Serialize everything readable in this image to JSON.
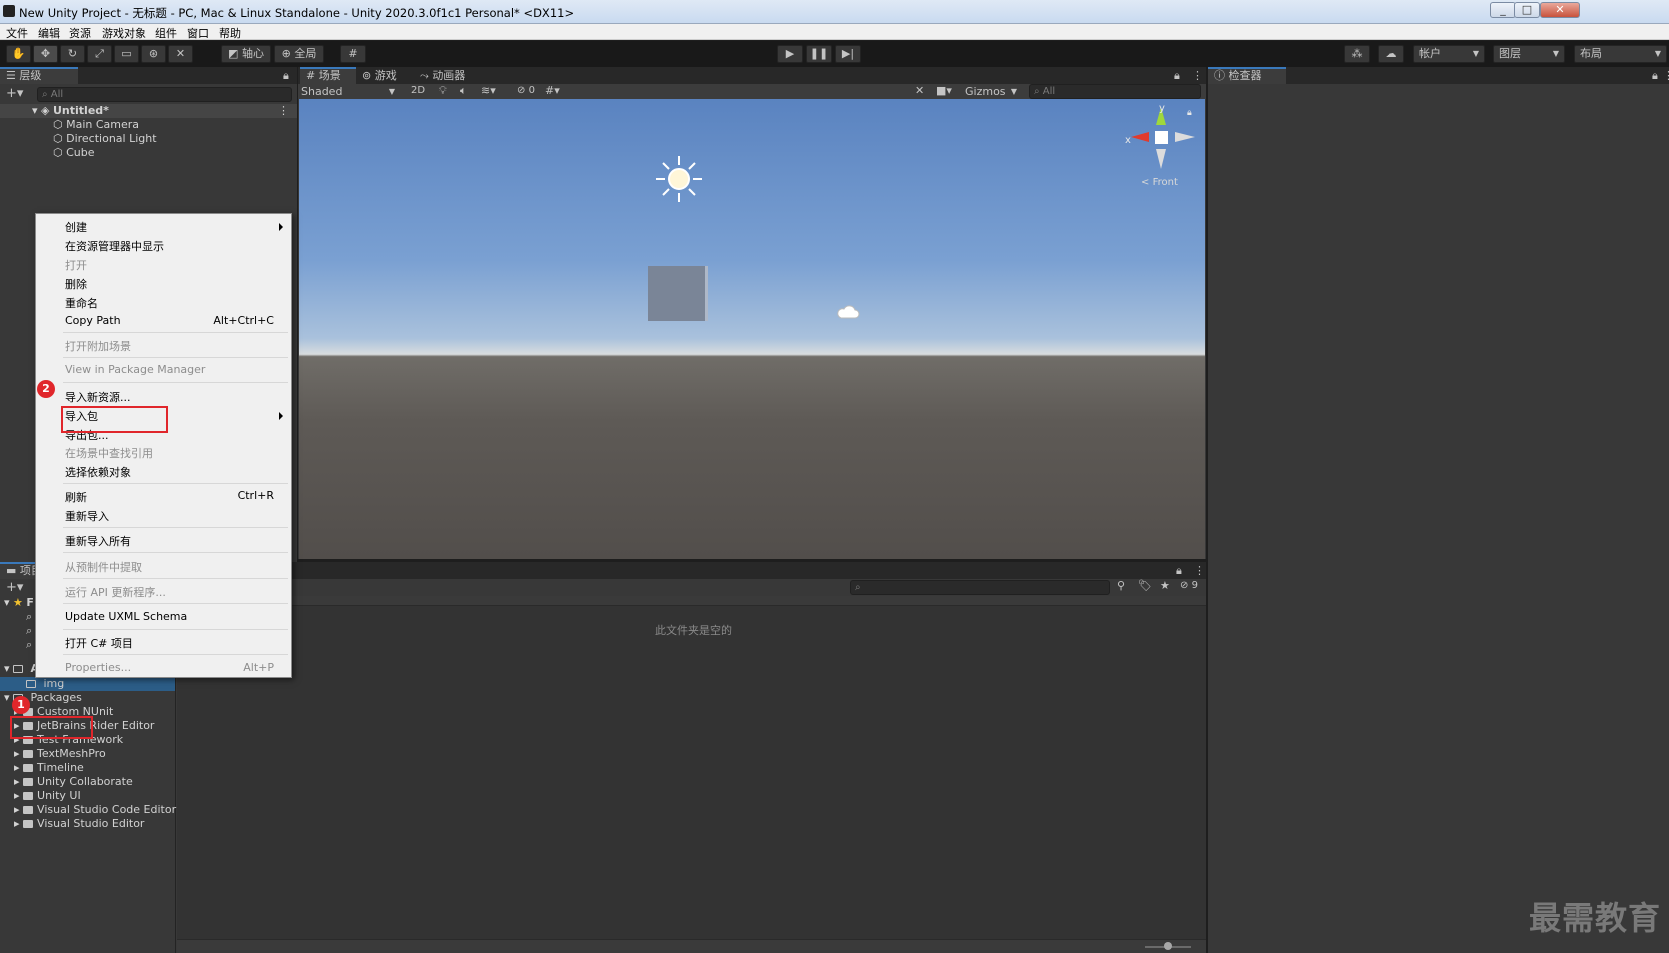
{
  "titlebar": {
    "title": "New Unity Project - 无标题 - PC, Mac & Linux Standalone - Unity 2020.3.0f1c1 Personal* <DX11>",
    "minimize": "_",
    "maximize": "□",
    "close": "✕"
  },
  "menubar": {
    "items": [
      "文件",
      "编辑",
      "资源",
      "游戏对象",
      "组件",
      "窗口",
      "帮助"
    ]
  },
  "toolbar": {
    "pivot_label": "轴心",
    "global_label": "全局",
    "account_label": "帐户",
    "layers_label": "图层",
    "layout_label": "布局"
  },
  "hierarchy": {
    "tab_label": "层级",
    "search_placeholder": "All",
    "scene_name": "Untitled*",
    "objects": [
      "Main Camera",
      "Directional Light",
      "Cube"
    ]
  },
  "scene_view": {
    "tabs": [
      "场景",
      "游戏",
      "动画器"
    ],
    "shading_mode": "Shaded",
    "mode_2d": "2D",
    "hidden_count": "0",
    "gizmos_label": "Gizmos",
    "search_placeholder": "All",
    "orientation_label": "Front",
    "axis_x": "x",
    "axis_y": "y"
  },
  "inspector": {
    "tab_label": "检查器"
  },
  "project": {
    "tab_label": "项目",
    "empty_message": "此文件夹是空的",
    "hidden_count": "9",
    "favorites_label": "F",
    "assets_label": "A",
    "selected_folder": "img",
    "packages_label": "Packages",
    "packages": [
      "Custom NUnit",
      "JetBrains Rider Editor",
      "Test Framework",
      "TextMeshPro",
      "Timeline",
      "Unity Collaborate",
      "Unity UI",
      "Visual Studio Code Editor",
      "Visual Studio Editor"
    ]
  },
  "context_menu": {
    "items": [
      {
        "label": "创建",
        "shortcut": "",
        "disabled": false,
        "submenu": true
      },
      {
        "label": "在资源管理器中显示",
        "shortcut": "",
        "disabled": false,
        "submenu": false
      },
      {
        "label": "打开",
        "shortcut": "",
        "disabled": true,
        "submenu": false
      },
      {
        "label": "删除",
        "shortcut": "",
        "disabled": false,
        "submenu": false
      },
      {
        "label": "重命名",
        "shortcut": "",
        "disabled": false,
        "submenu": false
      },
      {
        "label": "Copy Path",
        "shortcut": "Alt+Ctrl+C",
        "disabled": false,
        "submenu": false
      },
      {
        "label": "打开附加场景",
        "shortcut": "",
        "disabled": true,
        "submenu": false
      },
      {
        "label": "View in Package Manager",
        "shortcut": "",
        "disabled": true,
        "submenu": false
      },
      {
        "label": "导入新资源...",
        "shortcut": "",
        "disabled": false,
        "submenu": false
      },
      {
        "label": "导入包",
        "shortcut": "",
        "disabled": false,
        "submenu": true
      },
      {
        "label": "导出包...",
        "shortcut": "",
        "disabled": false,
        "submenu": false
      },
      {
        "label": "在场景中查找引用",
        "shortcut": "",
        "disabled": true,
        "submenu": false
      },
      {
        "label": "选择依赖对象",
        "shortcut": "",
        "disabled": false,
        "submenu": false
      },
      {
        "label": "刷新",
        "shortcut": "Ctrl+R",
        "disabled": false,
        "submenu": false
      },
      {
        "label": "重新导入",
        "shortcut": "",
        "disabled": false,
        "submenu": false
      },
      {
        "label": "重新导入所有",
        "shortcut": "",
        "disabled": false,
        "submenu": false
      },
      {
        "label": "从预制件中提取",
        "shortcut": "",
        "disabled": true,
        "submenu": false
      },
      {
        "label": "运行 API 更新程序...",
        "shortcut": "",
        "disabled": true,
        "submenu": false
      },
      {
        "label": "Update UXML Schema",
        "shortcut": "",
        "disabled": false,
        "submenu": false
      },
      {
        "label": "打开 C# 项目",
        "shortcut": "",
        "disabled": false,
        "submenu": false
      },
      {
        "label": "Properties...",
        "shortcut": "Alt+P",
        "disabled": true,
        "submenu": false
      }
    ]
  },
  "annotations": {
    "step1": "1",
    "step2": "2"
  },
  "watermark": "最需教育",
  "colors": {
    "selection": "#2c5d87",
    "highlight_box": "#e0262b",
    "tab_accent": "#3a79bb"
  }
}
